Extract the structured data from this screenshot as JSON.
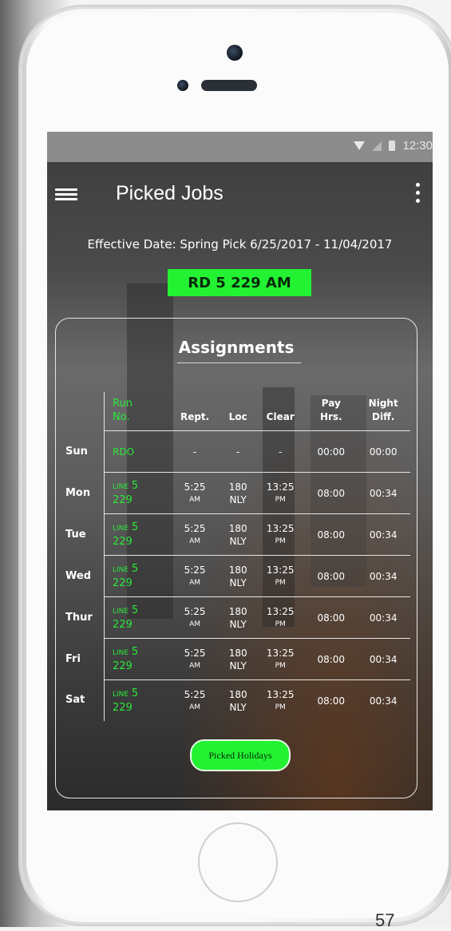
{
  "status_bar": {
    "time": "12:30"
  },
  "app_bar": {
    "title": "Picked Jobs"
  },
  "effective_date": "Effective Date: Spring Pick 6/25/2017 - 11/04/2017",
  "run_badge": "RD 5 229 AM",
  "assignments": {
    "title": "Assignments",
    "headers": {
      "run": [
        "Run",
        "No."
      ],
      "rept": "Rept.",
      "loc": "Loc",
      "clear": "Clear",
      "pay": [
        "Pay",
        "Hrs."
      ],
      "night": [
        "Night",
        "Diff."
      ]
    },
    "rows": [
      {
        "day": "Sun",
        "run": "RDO",
        "rept": "-",
        "loc": "-",
        "clear": "-",
        "pay": "00:00",
        "night": "00:00"
      },
      {
        "day": "Mon",
        "line": "LINE",
        "line_num": "5",
        "run_num": "229",
        "rept_time": "5:25",
        "rept_ampm": "AM",
        "loc_num": "180",
        "loc_code": "NLY",
        "clear_time": "13:25",
        "clear_ampm": "PM",
        "pay": "08:00",
        "night": "00:34"
      },
      {
        "day": "Tue",
        "line": "LINE",
        "line_num": "5",
        "run_num": "229",
        "rept_time": "5:25",
        "rept_ampm": "AM",
        "loc_num": "180",
        "loc_code": "NLY",
        "clear_time": "13:25",
        "clear_ampm": "PM",
        "pay": "08:00",
        "night": "00:34"
      },
      {
        "day": "Wed",
        "line": "LINE",
        "line_num": "5",
        "run_num": "229",
        "rept_time": "5:25",
        "rept_ampm": "AM",
        "loc_num": "180",
        "loc_code": "NLY",
        "clear_time": "13:25",
        "clear_ampm": "PM",
        "pay": "08:00",
        "night": "00:34"
      },
      {
        "day": "Thur",
        "line": "LINE",
        "line_num": "5",
        "run_num": "229",
        "rept_time": "5:25",
        "rept_ampm": "AM",
        "loc_num": "180",
        "loc_code": "NLY",
        "clear_time": "13:25",
        "clear_ampm": "PM",
        "pay": "08:00",
        "night": "00:34"
      },
      {
        "day": "Fri",
        "line": "LINE",
        "line_num": "5",
        "run_num": "229",
        "rept_time": "5:25",
        "rept_ampm": "AM",
        "loc_num": "180",
        "loc_code": "NLY",
        "clear_time": "13:25",
        "clear_ampm": "PM",
        "pay": "08:00",
        "night": "00:34"
      },
      {
        "day": "Sat",
        "line": "LINE",
        "line_num": "5",
        "run_num": "229",
        "rept_time": "5:25",
        "rept_ampm": "AM",
        "loc_num": "180",
        "loc_code": "NLY",
        "clear_time": "13:25",
        "clear_ampm": "PM",
        "pay": "08:00",
        "night": "00:34"
      }
    ],
    "button": "Picked Holidays"
  },
  "page_number": "57",
  "colors": {
    "accent_green": "#22f232",
    "status_bar": "#8c8c8c"
  }
}
